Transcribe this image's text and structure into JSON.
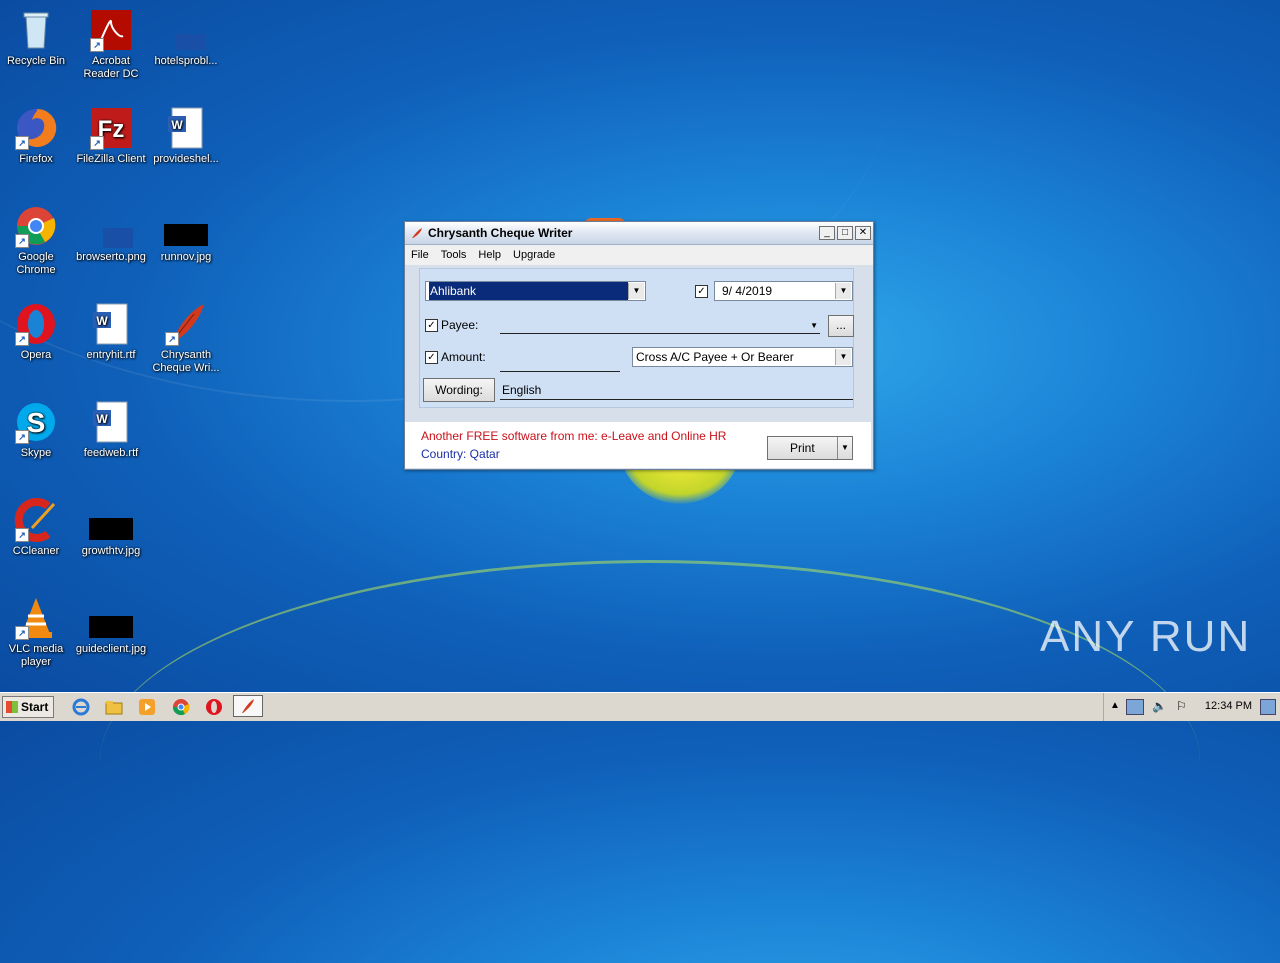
{
  "desktop": {
    "icons": [
      {
        "label": "Recycle Bin"
      },
      {
        "label": "Acrobat Reader DC"
      },
      {
        "label": "hotelsprobl..."
      },
      {
        "label": "Firefox"
      },
      {
        "label": "FileZilla Client"
      },
      {
        "label": "provideshel..."
      },
      {
        "label": "Google Chrome"
      },
      {
        "label": "browserto.png"
      },
      {
        "label": "runnov.jpg"
      },
      {
        "label": "Opera"
      },
      {
        "label": "entryhit.rtf"
      },
      {
        "label": "Chrysanth Cheque Wri..."
      },
      {
        "label": "Skype"
      },
      {
        "label": "feedweb.rtf"
      },
      {
        "label": "CCleaner"
      },
      {
        "label": "growthtv.jpg"
      },
      {
        "label": "VLC media player"
      },
      {
        "label": "guideclient.jpg"
      }
    ]
  },
  "window": {
    "title": "Chrysanth Cheque Writer",
    "menu": [
      "File",
      "Tools",
      "Help",
      "Upgrade"
    ],
    "bank_select": "Ahlibank",
    "date_value": "9/ 4/2019",
    "payee_label": "Payee:",
    "amount_label": "Amount:",
    "payee_type_select": "Cross A/C Payee + Or Bearer",
    "wording_button": "Wording:",
    "wording_value": "English",
    "browse_button": "...",
    "promo_text": "Another FREE software from me: e-Leave and Online HR",
    "country_text": "Country: Qatar",
    "print_button": "Print"
  },
  "taskbar": {
    "start_label": "Start",
    "clock": "12:34 PM"
  },
  "watermark": "ANY RUN"
}
